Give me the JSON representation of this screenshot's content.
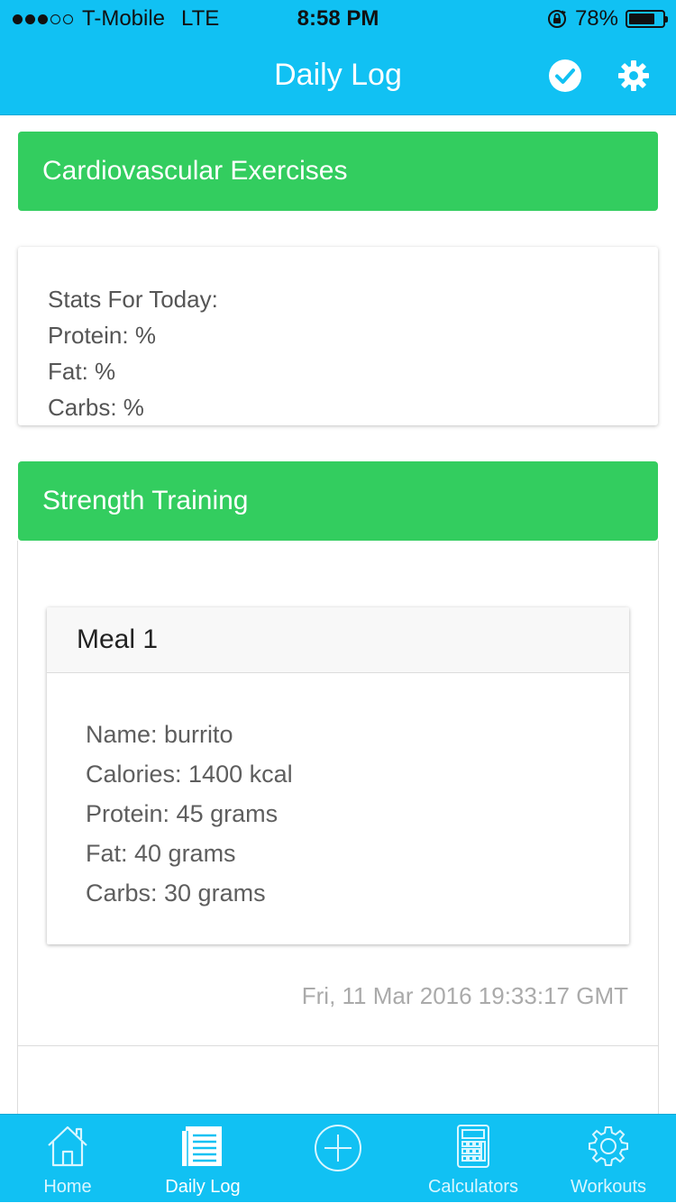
{
  "status_bar": {
    "carrier": "T-Mobile",
    "network": "LTE",
    "time": "8:58 PM",
    "battery_percent_label": "78%",
    "battery_level": 0.78,
    "signal_bars": 3
  },
  "nav": {
    "title": "Daily Log",
    "check_icon": "check-circle-icon",
    "settings_icon": "gear-icon"
  },
  "sections": {
    "cardio_title": "Cardiovascular Exercises",
    "strength_title": "Strength Training"
  },
  "stats": {
    "heading": "Stats For Today:",
    "protein": "Protein: %",
    "fat": "Fat: %",
    "carbs": "Carbs: %"
  },
  "meal": {
    "title": "Meal 1",
    "name": "Name: burrito",
    "calories": "Calories: 1400 kcal",
    "protein": "Protein: 45 grams",
    "fat": "Fat: 40 grams",
    "carbs": "Carbs: 30 grams",
    "timestamp": "Fri, 11 Mar 2016 19:33:17 GMT"
  },
  "tabs": [
    {
      "label": "Home",
      "icon": "home-icon"
    },
    {
      "label": "Daily Log",
      "icon": "document-icon",
      "active": true
    },
    {
      "label": "",
      "icon": "add-circle-icon"
    },
    {
      "label": "Calculators",
      "icon": "calculator-icon"
    },
    {
      "label": "Workouts",
      "icon": "gear-icon"
    }
  ],
  "colors": {
    "primary": "#11c1f3",
    "success": "#33cd5f"
  }
}
